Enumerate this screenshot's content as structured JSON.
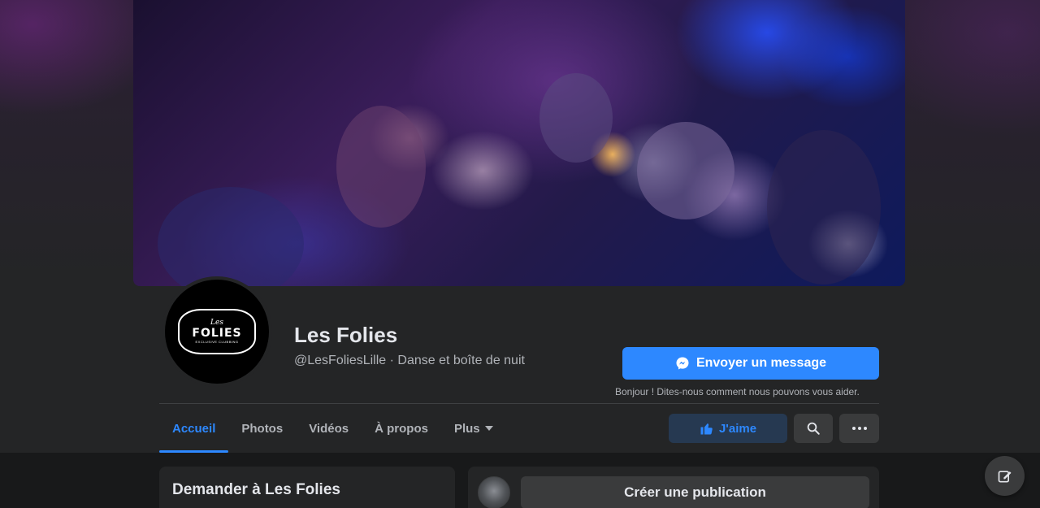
{
  "page": {
    "name": "Les Folies",
    "handle_category": "@LesFoliesLille · Danse et boîte de nuit"
  },
  "logo": {
    "top_text": "Les",
    "main_text": "FOLIES",
    "sub_text": "EXCLUSIVE CLUBBING"
  },
  "actions": {
    "message_label": "Envoyer un message",
    "message_hint": "Bonjour ! Dites-nous comment nous pouvons vous aider.",
    "like_label": "J'aime"
  },
  "tabs": [
    {
      "label": "Accueil",
      "active": true
    },
    {
      "label": "Photos",
      "active": false
    },
    {
      "label": "Vidéos",
      "active": false
    },
    {
      "label": "À propos",
      "active": false
    },
    {
      "label": "Plus",
      "active": false
    }
  ],
  "cards": {
    "ask_title": "Demander à Les Folies",
    "create_post_label": "Créer une publication"
  },
  "icons": {
    "messenger": "messenger-icon",
    "like": "thumbs-up-icon",
    "search": "search-icon",
    "more": "more-dots-icon",
    "compose": "compose-icon",
    "tab_caret": "chevron-down-icon"
  },
  "colors": {
    "accent": "#2d88ff",
    "background": "#18191a",
    "surface": "#242526",
    "button": "#3a3b3c",
    "like_bg": "#263951"
  }
}
